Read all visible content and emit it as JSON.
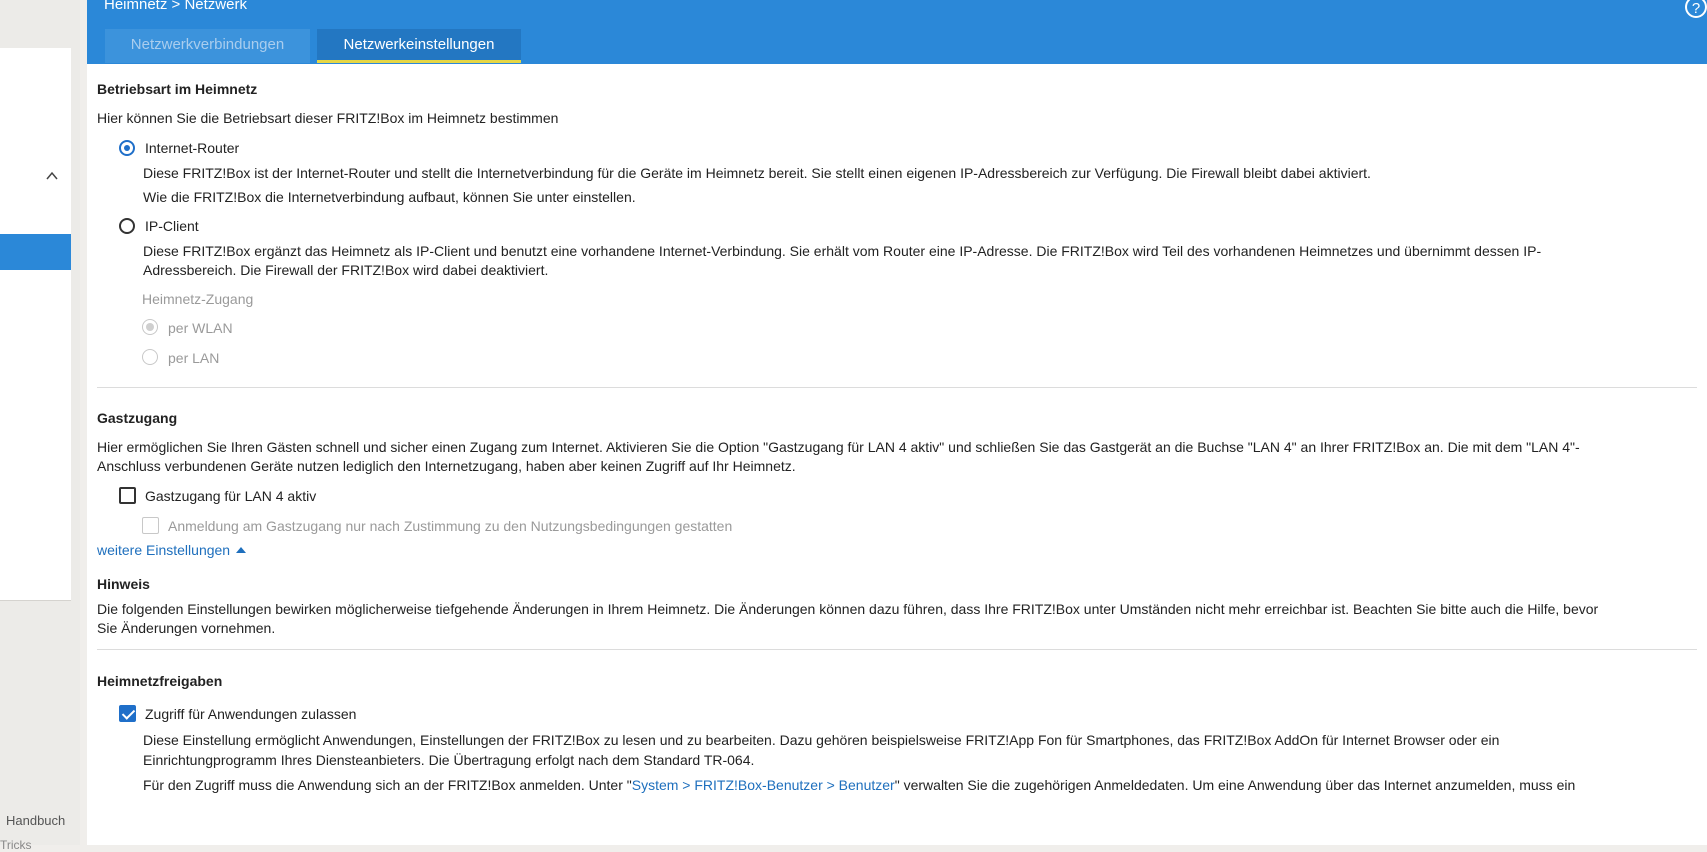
{
  "header": {
    "breadcrumb": "Heimnetz > Netzwerk",
    "help_icon": "?",
    "tabs": [
      {
        "label": "Netzwerkverbindungen",
        "active": false
      },
      {
        "label": "Netzwerkeinstellungen",
        "active": true
      }
    ]
  },
  "sidebar": {
    "link_handbuch": "Handbuch",
    "link_tricks": "Tricks"
  },
  "betriebsart": {
    "title": "Betriebsart im Heimnetz",
    "intro": "Hier können Sie die Betriebsart dieser FRITZ!Box im Heimnetz bestimmen",
    "router_label": "Internet-Router",
    "router_desc1": "Diese FRITZ!Box ist der Internet-Router und stellt die Internetverbindung für die Geräte im Heimnetz bereit. Sie stellt einen eigenen IP-Adressbereich zur Verfügung. Die Firewall bleibt dabei aktiviert.",
    "router_desc2": "Wie die FRITZ!Box die Internetverbindung aufbaut, können Sie unter einstellen.",
    "client_label": "IP-Client",
    "client_desc1": "Diese FRITZ!Box ergänzt das Heimnetz als IP-Client und benutzt eine vorhandene Internet-Verbindung. Sie erhält vom Router eine IP-Adresse. Die FRITZ!Box wird Teil des vorhandenen Heimnetzes und übernimmt dessen IP-",
    "client_desc2": "Adressbereich. Die Firewall der FRITZ!Box wird dabei deaktiviert.",
    "zugang_label": "Heimnetz-Zugang",
    "wlan_label": "per WLAN",
    "lan_label": "per LAN"
  },
  "gastzugang": {
    "title": "Gastzugang",
    "desc1": "Hier ermöglichen Sie Ihren Gästen schnell und sicher einen Zugang zum Internet. Aktivieren Sie die Option \"Gastzugang für LAN 4 aktiv\" und schließen Sie das Gastgerät an die Buchse \"LAN 4\" an Ihrer FRITZ!Box an. Die mit dem \"LAN 4\"-",
    "desc2": "Anschluss verbundenen Geräte nutzen lediglich den Internetzugang, haben aber keinen Zugriff auf Ihr Heimnetz.",
    "checkbox_label": "Gastzugang für LAN 4 aktiv",
    "consent_label": "Anmeldung am Gastzugang nur nach Zustimmung zu den Nutzungsbedingungen gestatten"
  },
  "weitere_link": "weitere Einstellungen",
  "hinweis": {
    "title": "Hinweis",
    "desc1": "Die folgenden Einstellungen bewirken möglicherweise tiefgehende Änderungen in Ihrem Heimnetz. Die Änderungen können dazu führen, dass Ihre FRITZ!Box unter Umständen nicht mehr erreichbar ist. Beachten Sie bitte auch die Hilfe, bevor",
    "desc2": "Sie Änderungen vornehmen."
  },
  "freigaben": {
    "title": "Heimnetzfreigaben",
    "checkbox_label": "Zugriff für Anwendungen zulassen",
    "desc1": "Diese Einstellung ermöglicht Anwendungen, Einstellungen der FRITZ!Box zu lesen und zu bearbeiten. Dazu gehören beispielsweise FRITZ!App Fon für Smartphones, das FRITZ!Box AddOn für Internet Browser oder ein",
    "desc2": "Einrichtungprogramm Ihres Diensteanbieters. Die Übertragung erfolgt nach dem Standard TR-064.",
    "desc3_pre": "Für den Zugriff muss die Anwendung sich an der FRITZ!Box anmelden. Unter \"",
    "desc3_link": "System > FRITZ!Box-Benutzer > Benutzer",
    "desc3_post": "\" verwalten Sie die zugehörigen Anmeldedaten. Um eine Anwendung über das Internet anzumelden, muss ein"
  }
}
